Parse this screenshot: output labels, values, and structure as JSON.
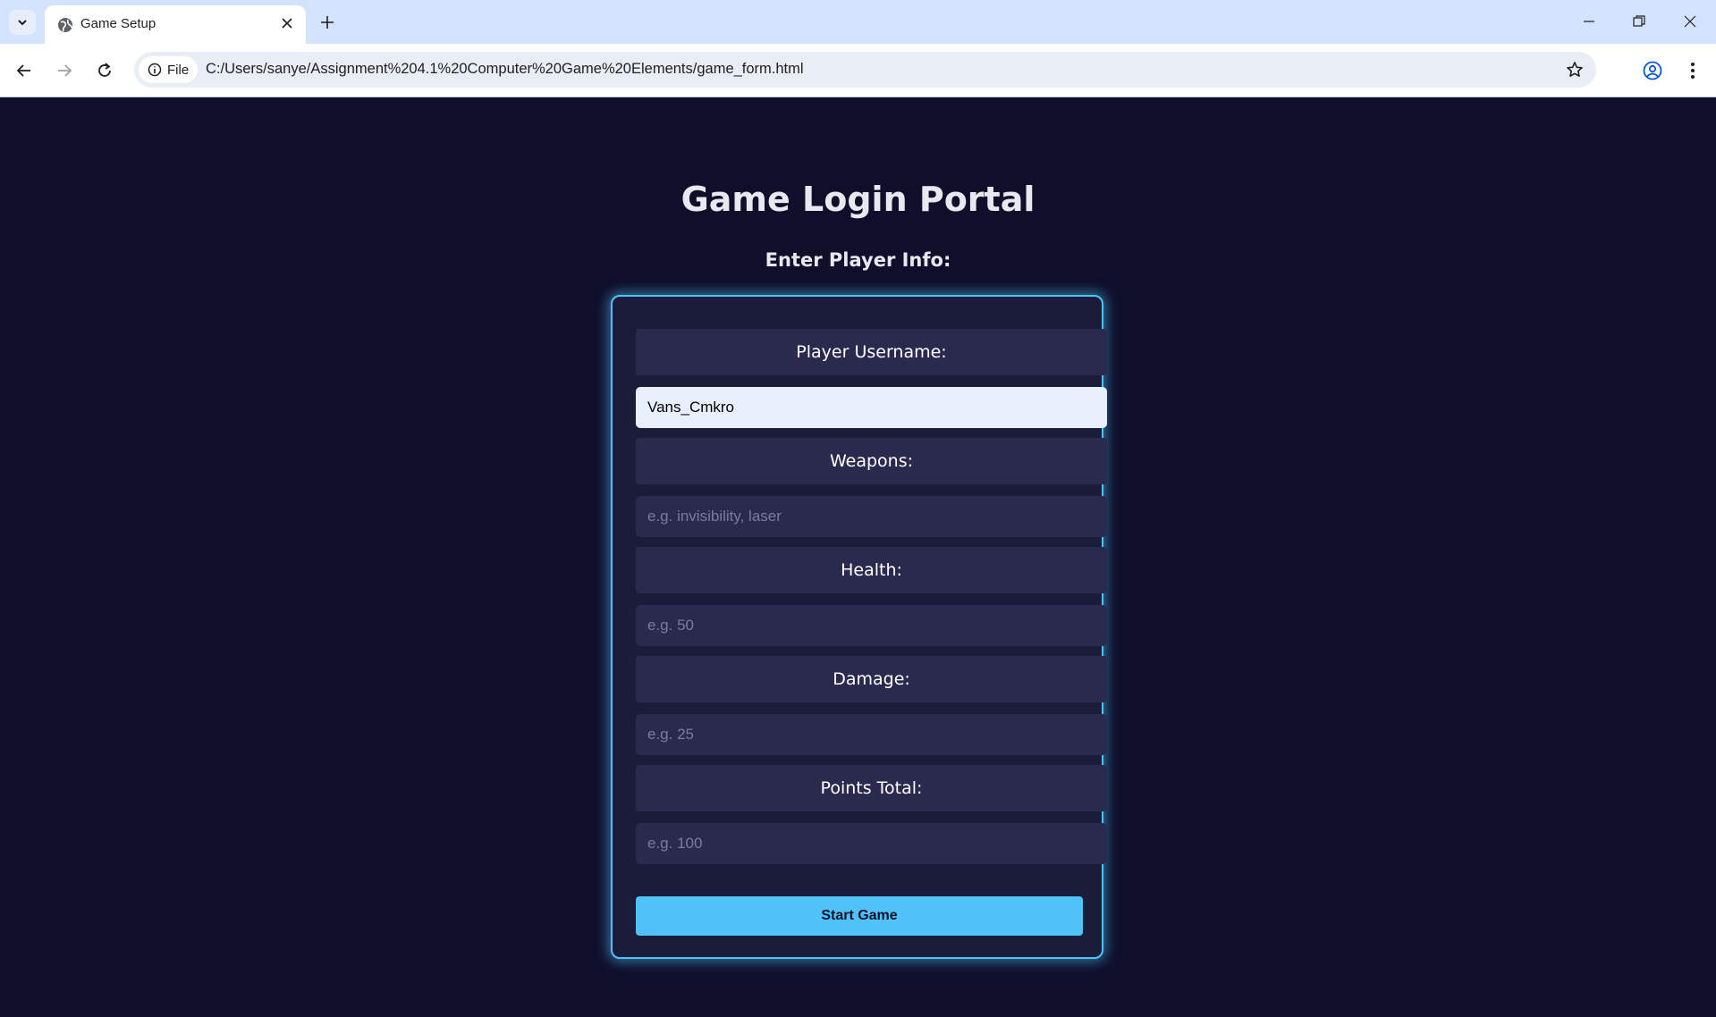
{
  "browser": {
    "tab_title": "Game Setup",
    "chip_label": "File",
    "url": "C:/Users/sanye/Assignment%204.1%20Computer%20Game%20Elements/game_form.html"
  },
  "page": {
    "title": "Game Login Portal",
    "subtitle": "Enter Player Info:"
  },
  "form": {
    "username": {
      "label": "Player Username:",
      "value": "Vans_Cmkro",
      "placeholder": ""
    },
    "weapons": {
      "label": "Weapons:",
      "value": "",
      "placeholder": "e.g. invisibility, laser"
    },
    "health": {
      "label": "Health:",
      "value": "",
      "placeholder": "e.g. 50"
    },
    "damage": {
      "label": "Damage:",
      "value": "",
      "placeholder": "e.g. 25"
    },
    "points": {
      "label": "Points Total:",
      "value": "",
      "placeholder": "e.g. 100"
    },
    "submit_label": "Start Game"
  },
  "colors": {
    "page_background": "#0f0f2b",
    "card_background": "#1b1b3a",
    "accent": "#4fc3f7",
    "label_background": "#2a2a4f"
  },
  "icons": [
    "tab-search-icon",
    "globe-icon",
    "close-icon",
    "plus-icon",
    "minimize-icon",
    "restore-icon",
    "window-close-icon",
    "back-arrow-icon",
    "forward-arrow-icon",
    "reload-icon",
    "info-icon",
    "star-icon",
    "profile-icon",
    "kebab-menu-icon"
  ]
}
